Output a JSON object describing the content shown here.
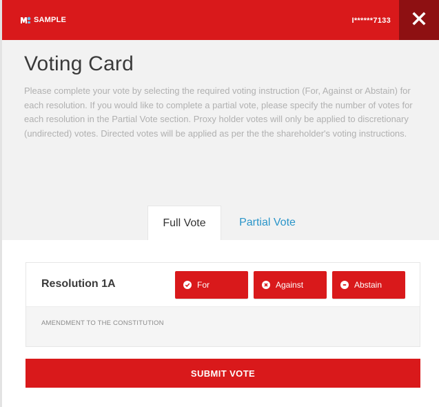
{
  "brand": {
    "name": "SAMPLE",
    "logo_icon": "mp-logo-icon"
  },
  "account": {
    "masked_id": "I******7133"
  },
  "header": {
    "title": "Voting Card",
    "description": "Please complete your vote by selecting the required voting instruction (For, Against or Abstain) for each resolution. If you would like to complete a partial vote, please specify the number of votes for each resolution in the Partial Vote section. Proxy holder votes will only be applied to discretionary (undirected) votes. Directed votes will be applied as per the the shareholder's voting instructions."
  },
  "tabs": [
    {
      "label": "Full Vote",
      "active": true
    },
    {
      "label": "Partial Vote",
      "active": false
    }
  ],
  "resolution": {
    "title": "Resolution 1A",
    "description": "AMENDMENT TO THE CONSTITUTION",
    "options": [
      {
        "label": "For",
        "icon": "check-circle-icon"
      },
      {
        "label": "Against",
        "icon": "x-circle-icon"
      },
      {
        "label": "Abstain",
        "icon": "minus-circle-icon"
      }
    ]
  },
  "submit": {
    "label": "SUBMIT VOTE"
  },
  "colors": {
    "brand_red": "#d9191b",
    "close_dark_red": "#8e1012",
    "tab_link_blue": "#2a95c9",
    "header_bg": "#f2f2f2"
  }
}
